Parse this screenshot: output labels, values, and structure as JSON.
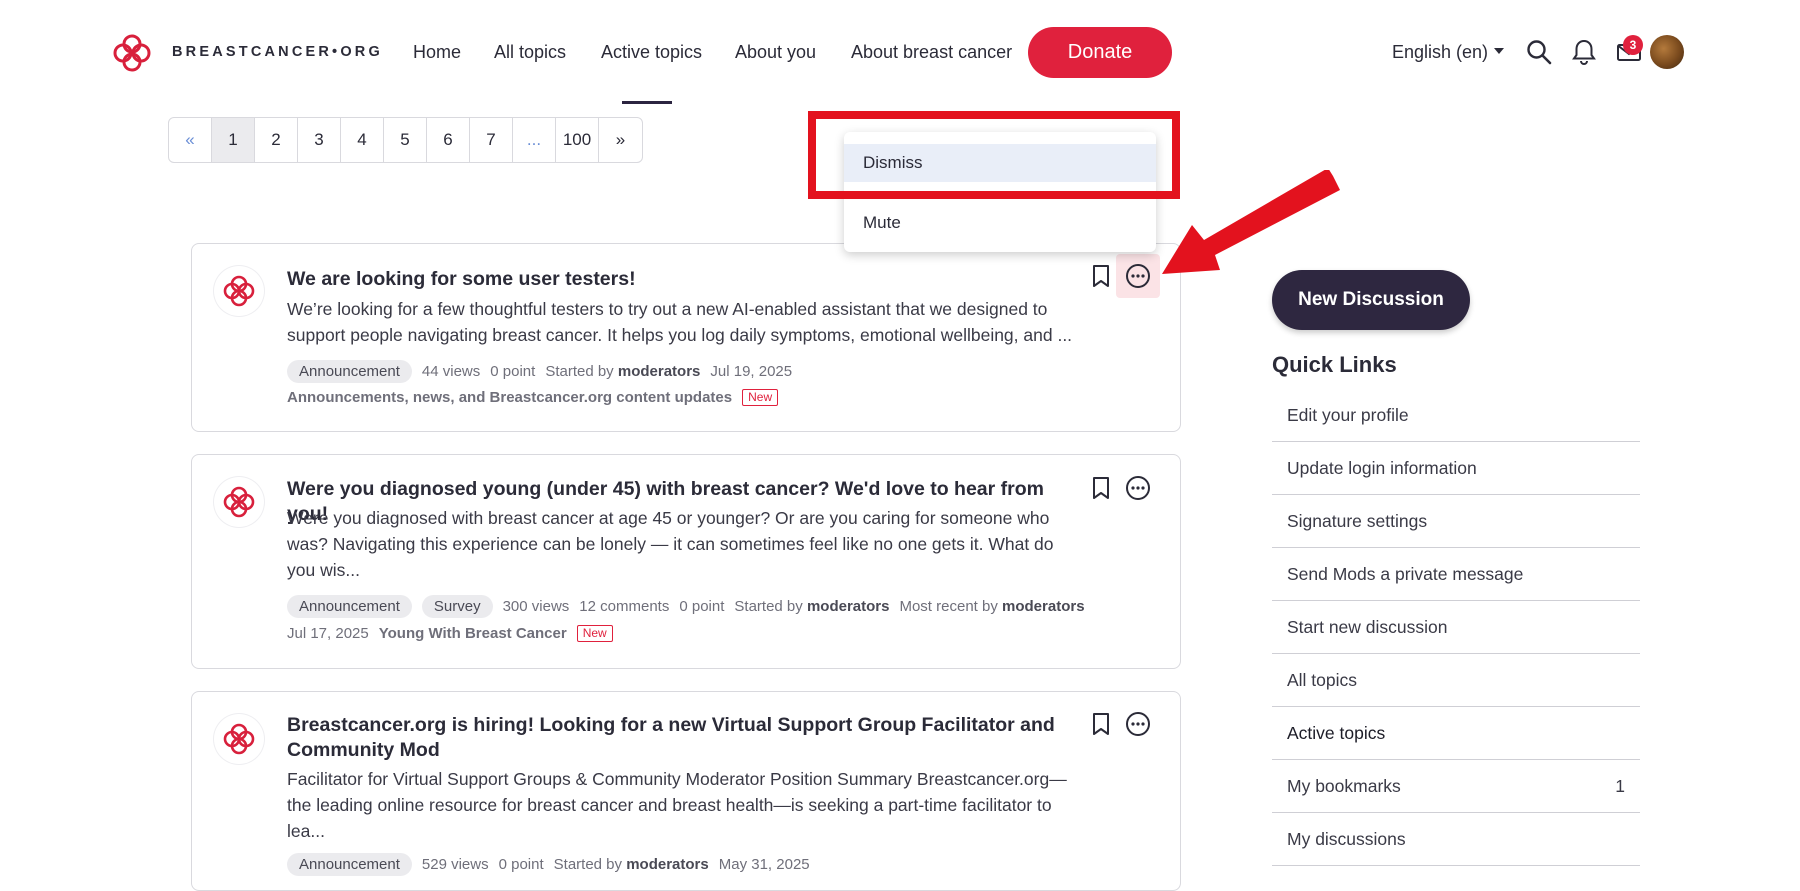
{
  "header": {
    "logo_text": "BREASTCANCER•ORG",
    "nav": [
      "Home",
      "All topics",
      "Active topics",
      "About you",
      "About breast cancer"
    ],
    "donate_label": "Donate",
    "language": "English (en)",
    "messages_badge": "3"
  },
  "pagination": {
    "prev": "«",
    "pages": [
      "1",
      "2",
      "3",
      "4",
      "5",
      "6",
      "7",
      "...",
      "100"
    ],
    "next": "»",
    "current": "1"
  },
  "dropdown": {
    "items": [
      "Dismiss",
      "Mute"
    ]
  },
  "discussions": [
    {
      "title": "We are looking for some user testers!",
      "excerpt": "We’re looking for a few thoughtful testers to try out a new AI-enabled assistant that we designed to support people navigating breast cancer. It helps you log daily symptoms, emotional wellbeing, and ...",
      "tags": [
        "Announcement"
      ],
      "views": "44 views",
      "points": "0 point",
      "started_label": "Started by",
      "author": "moderators",
      "date": "Jul 19, 2025",
      "category": "Announcements, news, and Breastcancer.org content updates",
      "new_label": "New"
    },
    {
      "title": "Were you diagnosed young (under 45) with breast cancer? We'd love to hear from you!",
      "excerpt": "Were you diagnosed with breast cancer at age 45 or younger? Or are you caring for someone who was? Navigating this experience can be lonely — it can sometimes feel like no one gets it. What do you wis...",
      "tags": [
        "Announcement",
        "Survey"
      ],
      "views": "300 views",
      "comments": "12 comments",
      "points": "0 point",
      "started_label": "Started by",
      "author": "moderators",
      "recent_label": "Most recent by",
      "recent_author": "moderators",
      "date": "Jul 17, 2025",
      "category": "Young With Breast Cancer",
      "new_label": "New"
    },
    {
      "title": "Breastcancer.org is hiring! Looking for a new Virtual Support Group Facilitator and Community Mod",
      "excerpt": "Facilitator for Virtual Support Groups & Community Moderator Position Summary Breastcancer.org—the leading online resource for breast cancer and breast health—is seeking a part-time facilitator to lea...",
      "tags": [
        "Announcement"
      ],
      "views": "529 views",
      "points": "0 point",
      "started_label": "Started by",
      "author": "moderators",
      "date": "May 31, 2025"
    }
  ],
  "sidebar": {
    "new_discussion": "New Discussion",
    "quick_links_title": "Quick Links",
    "links": [
      {
        "label": "Edit your profile",
        "count": ""
      },
      {
        "label": "Update login information",
        "count": ""
      },
      {
        "label": "Signature settings",
        "count": ""
      },
      {
        "label": "Send Mods a private message",
        "count": ""
      },
      {
        "label": "Start new discussion",
        "count": ""
      },
      {
        "label": "All topics",
        "count": ""
      },
      {
        "label": "Active topics",
        "count": ""
      },
      {
        "label": "My bookmarks",
        "count": "1"
      },
      {
        "label": "My discussions",
        "count": ""
      }
    ]
  },
  "colors": {
    "brand_red": "#e0213d",
    "dark_button": "#2e2740",
    "annotation_red": "#e3121e"
  }
}
